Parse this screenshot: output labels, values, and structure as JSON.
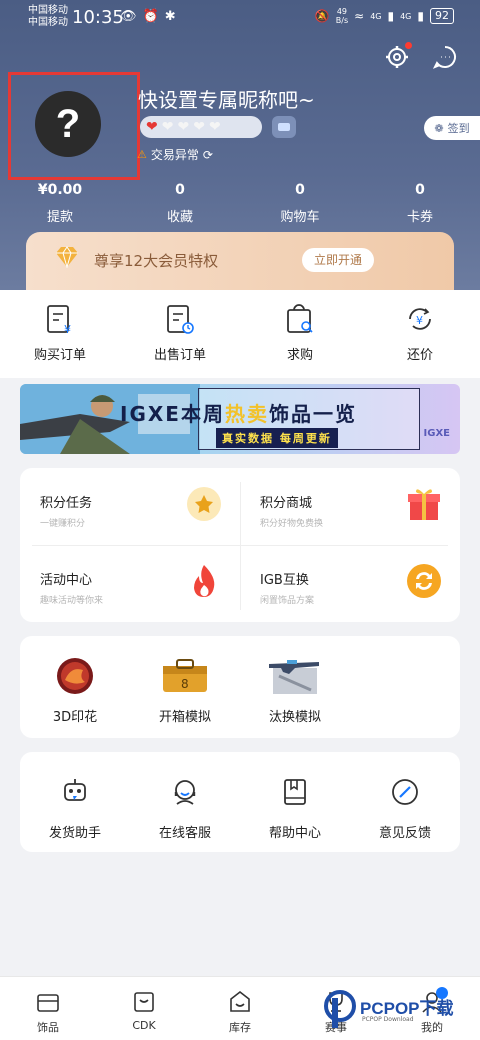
{
  "status_bar": {
    "carrier_1": "中国移动",
    "carrier_2": "中国移动",
    "time": "10:35",
    "speed_value": "49",
    "speed_unit": "B/s",
    "signal_1": "4G",
    "signal_2": "4G",
    "battery": "92"
  },
  "profile": {
    "nickname": "快设置专属昵称吧~",
    "avatar_symbol": "?",
    "hearts_filled": 1,
    "hearts_total": 5,
    "signin_label": "签到",
    "trade_status": "交易异常"
  },
  "stats": [
    {
      "value": "¥0.00",
      "label": "提款"
    },
    {
      "value": "0",
      "label": "收藏"
    },
    {
      "value": "0",
      "label": "购物车"
    },
    {
      "value": "0",
      "label": "卡券"
    }
  ],
  "vip": {
    "text": "尊享12大会员特权",
    "button": "立即开通"
  },
  "orders": [
    {
      "label": "购买订单",
      "icon": "purchase-order-icon"
    },
    {
      "label": "出售订单",
      "icon": "sale-order-icon"
    },
    {
      "label": "求购",
      "icon": "want-to-buy-icon"
    },
    {
      "label": "还价",
      "icon": "counter-offer-icon"
    }
  ],
  "banner": {
    "title_prefix": "IGXE本周",
    "title_hot": "热卖",
    "title_suffix": "饰品一览",
    "subtitle": "真实数据 每周更新",
    "logo": "IGXE"
  },
  "grid": [
    {
      "title": "积分任务",
      "sub": "一键赚积分",
      "icon": "star-icon"
    },
    {
      "title": "积分商城",
      "sub": "积分好物免费换",
      "icon": "gift-icon"
    },
    {
      "title": "活动中心",
      "sub": "趣味活动等你来",
      "icon": "flame-icon"
    },
    {
      "title": "IGB互换",
      "sub": "闲置饰品方案",
      "icon": "exchange-icon"
    }
  ],
  "tools": [
    {
      "label": "3D印花",
      "icon": "sticker-icon"
    },
    {
      "label": "开箱模拟",
      "icon": "case-icon"
    },
    {
      "label": "汰换模拟",
      "icon": "rifle-icon"
    }
  ],
  "services": [
    {
      "label": "发货助手",
      "icon": "robot-icon"
    },
    {
      "label": "在线客服",
      "icon": "headset-icon"
    },
    {
      "label": "帮助中心",
      "icon": "book-icon"
    },
    {
      "label": "意见反馈",
      "icon": "pen-icon"
    }
  ],
  "nav": [
    {
      "label": "饰品",
      "icon": "shop-icon"
    },
    {
      "label": "CDK",
      "icon": "cdk-icon"
    },
    {
      "label": "库存",
      "icon": "inventory-icon"
    },
    {
      "label": "赛事",
      "icon": "trophy-icon"
    },
    {
      "label": "我的",
      "icon": "profile-icon"
    }
  ],
  "watermark": {
    "text": "PCPOP下载",
    "sub": "PCPOP Download"
  },
  "colors": {
    "header": "#4b5d84",
    "vip_gold": "#f0c9a8",
    "accent_blue": "#1677ff",
    "heart_red": "#e53935"
  }
}
